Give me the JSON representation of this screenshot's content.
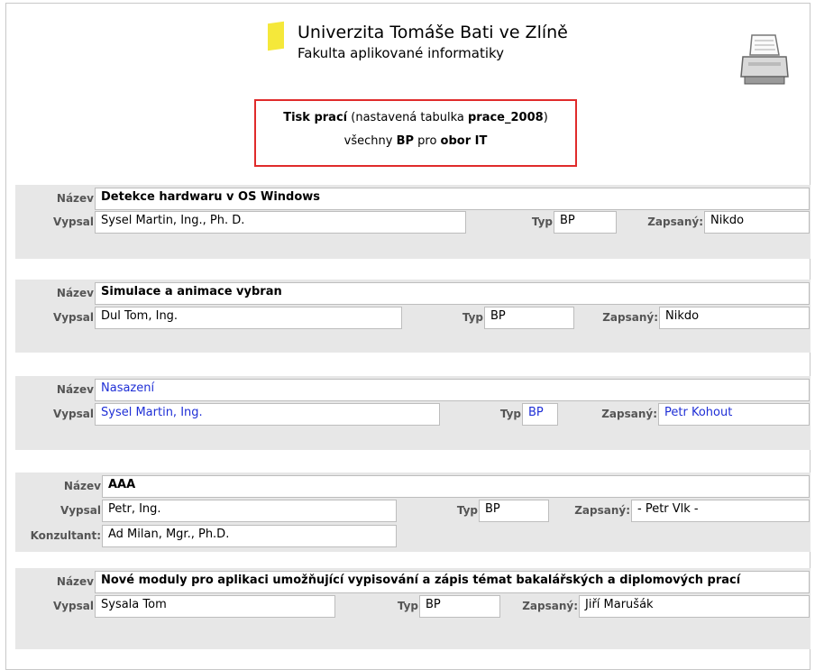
{
  "header": {
    "university": "Univerzita Tomáše Bati ve Zlíně",
    "faculty": "Fakulta aplikované informatiky"
  },
  "info": {
    "title": "Tisk prací",
    "mid": "(nastavená tabulka",
    "table": "prace_2008",
    "close": ")",
    "w1": "všechny",
    "w2": "BP",
    "w3": "pro",
    "w4": "obor IT"
  },
  "labels": {
    "nazev": "Název",
    "vypsal": "Vypsal",
    "typ": "Typ",
    "zapsany": "Zapsaný:",
    "konzultant": "Konzultant:"
  },
  "works": [
    {
      "nazev": "Detekce hardwaru v OS Windows",
      "vypsal": "Sysel Martin, Ing., Ph. D.",
      "typ": "BP",
      "zapsany": "Nikdo"
    },
    {
      "nazev": "Simulace a animace vybran",
      "vypsal": "Dul Tom, Ing.",
      "typ": "BP",
      "zapsany": "Nikdo"
    },
    {
      "nazev": "Nasazení",
      "vypsal": "Sysel Martin, Ing.",
      "typ": "BP",
      "zapsany": "Petr Kohout"
    },
    {
      "nazev": "AAA",
      "vypsal": "Petr, Ing.",
      "typ": "BP",
      "zapsany": "- Petr Vlk -",
      "konzultant": "Ad Milan, Mgr., Ph.D."
    },
    {
      "nazev": "Nové moduly pro aplikaci umožňující vypisování a zápis témat bakalářských a diplomových prací",
      "vypsal": "Sysala Tom",
      "typ": "BP",
      "zapsany": "Jiří Marušák"
    }
  ]
}
